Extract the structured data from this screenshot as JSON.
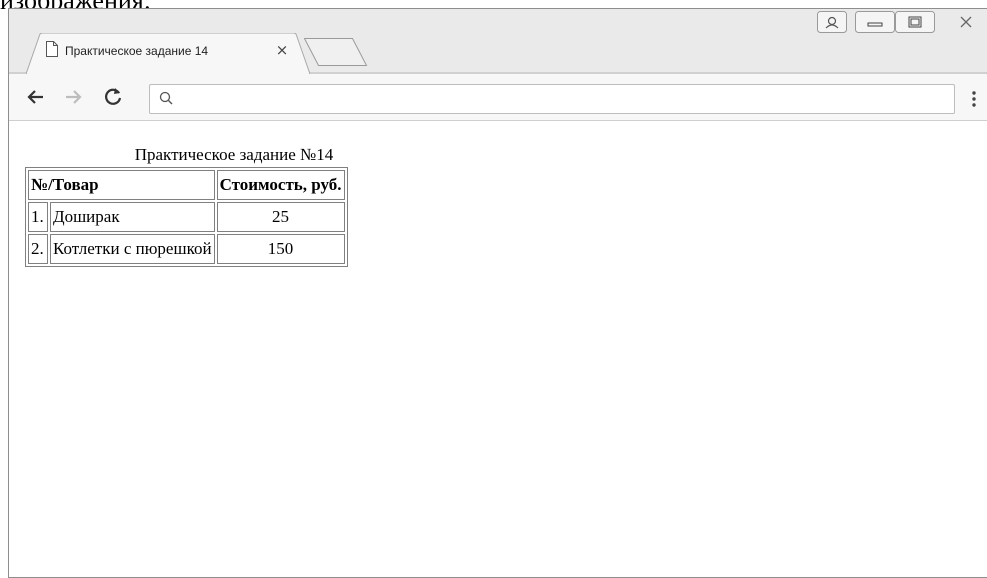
{
  "document_fragment": "изображения:",
  "browser": {
    "tab_title": "Практическое задание 14",
    "tab_close_glyph": "×",
    "address_value": "",
    "address_placeholder": ""
  },
  "page": {
    "caption": "Практическое задание №14",
    "headers": {
      "item": "№/Товар",
      "price": "Стоимость, руб."
    },
    "rows": [
      {
        "num": "1.",
        "name": "Доширак",
        "price": "25"
      },
      {
        "num": "2.",
        "name": "Котлетки с пюрешкой",
        "price": "150"
      }
    ]
  },
  "icons": {
    "back": "arrow-left-icon",
    "forward": "arrow-right-icon",
    "reload": "reload-icon",
    "search": "search-icon",
    "menu": "kebab-menu-icon",
    "user": "user-profile-icon",
    "minimize": "minimize-icon",
    "maximize": "maximize-icon",
    "close": "close-icon"
  },
  "colors": {
    "titlebar": "#eaeaea",
    "toolbar": "#f7f7f7",
    "table_border": "#808080"
  }
}
